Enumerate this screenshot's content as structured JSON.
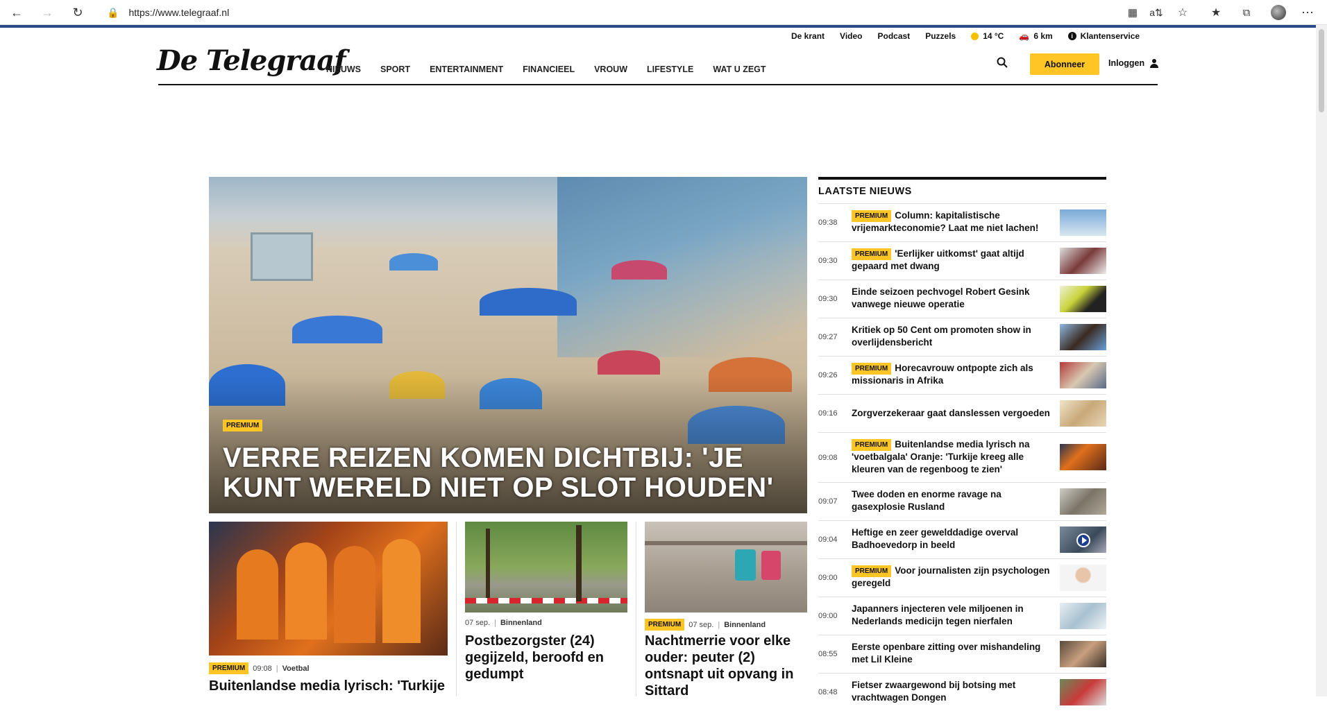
{
  "browser": {
    "url": "https://www.telegraaf.nl"
  },
  "topbar": {
    "krant": "De krant",
    "video": "Video",
    "podcast": "Podcast",
    "puzzels": "Puzzels",
    "weather": "14 °C",
    "traffic": "6 km",
    "service": "Klantenservice"
  },
  "logo": "De Telegraaf",
  "nav": [
    "NIEUWS",
    "SPORT",
    "ENTERTAINMENT",
    "FINANCIEEL",
    "VROUW",
    "LIFESTYLE",
    "WAT U ZEGT"
  ],
  "header": {
    "subscribe": "Abonneer",
    "login": "Inloggen"
  },
  "hero": {
    "badge": "PREMIUM",
    "title": "VERRE REIZEN KOMEN DICHTBIJ: 'JE KUNT WERELD NIET OP SLOT HOUDEN'"
  },
  "cards": [
    {
      "badge": "PREMIUM",
      "time": "09:08",
      "section": "Voetbal",
      "title": "Buitenlandse media lyrisch: 'Turkije"
    },
    {
      "time": "07 sep.",
      "section": "Binnenland",
      "title": "Postbezorgster (24) gegijzeld, beroofd en gedumpt"
    },
    {
      "badge": "PREMIUM",
      "time": "07 sep.",
      "section": "Binnenland",
      "title": "Nachtmerrie voor elke ouder: peuter (2) ontsnapt uit opvang in Sittard"
    }
  ],
  "latest": {
    "heading": "LAATSTE NIEUWS",
    "items": [
      {
        "time": "09:38",
        "premium": "PREMIUM",
        "title": "Column: kapitalistische vrijemarkteconomie? Laat me niet lachen!"
      },
      {
        "time": "09:30",
        "premium": "PREMIUM",
        "title": "'Eerlijker uitkomst' gaat altijd gepaard met dwang"
      },
      {
        "time": "09:30",
        "title": "Einde seizoen pechvogel Robert Gesink vanwege nieuwe operatie"
      },
      {
        "time": "09:27",
        "title": "Kritiek op 50 Cent om promoten show in overlijdensbericht"
      },
      {
        "time": "09:26",
        "premium": "PREMIUM",
        "title": "Horecavrouw ontpopte zich als missionaris in Afrika"
      },
      {
        "time": "09:16",
        "title": "Zorgverzekeraar gaat danslessen vergoeden"
      },
      {
        "time": "09:08",
        "premium": "PREMIUM",
        "title": "Buitenlandse media lyrisch na 'voetbalgala' Oranje: 'Turkije kreeg alle kleuren van de regenboog te zien'"
      },
      {
        "time": "09:07",
        "title": "Twee doden en enorme ravage na gasexplosie Rusland"
      },
      {
        "time": "09:04",
        "title": "Heftige en zeer gewelddadige overval Badhoevedorp in beeld"
      },
      {
        "time": "09:00",
        "premium": "PREMIUM",
        "title": "Voor journalisten zijn psychologen geregeld"
      },
      {
        "time": "09:00",
        "title": "Japanners injecteren vele miljoenen in Nederlands medicijn tegen nierfalen"
      },
      {
        "time": "08:55",
        "title": "Eerste openbare zitting over mishandeling met Lil Kleine"
      },
      {
        "time": "08:48",
        "title": "Fietser zwaargewond bij botsing met vrachtwagen Dongen"
      }
    ]
  }
}
